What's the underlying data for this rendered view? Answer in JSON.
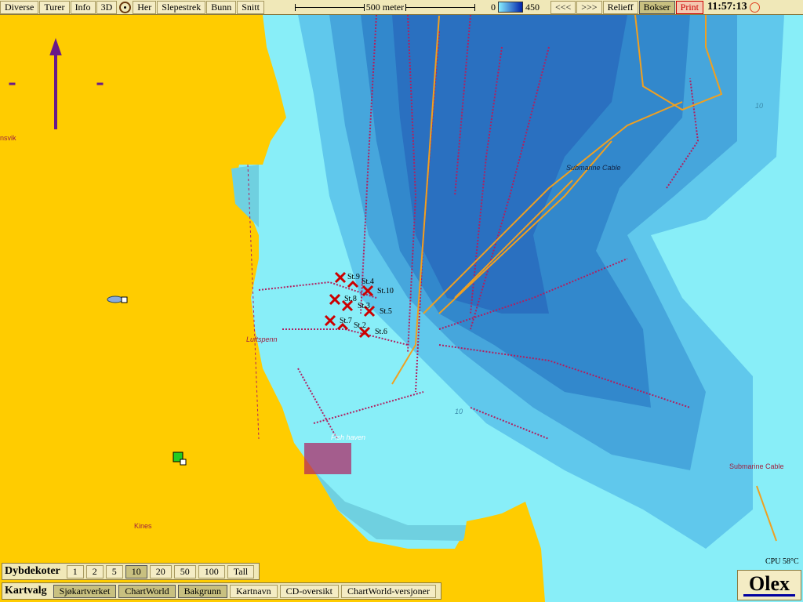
{
  "toolbar": {
    "buttons": [
      "Diverse",
      "Turer",
      "Info",
      "3D",
      "Her",
      "Slepestrek",
      "Bunn",
      "Snitt"
    ],
    "scale_label": "500 meter",
    "depth_min": "0",
    "depth_max": "450",
    "prev": "<<<",
    "next": ">>>",
    "relief": "Relieff",
    "bokser": "Bokser",
    "print": "Print",
    "time": "11:57:13"
  },
  "dybdekoter": {
    "label": "Dybdekoter",
    "options": [
      "1",
      "2",
      "5",
      "10",
      "20",
      "50",
      "100",
      "Tall"
    ],
    "selected": "10"
  },
  "kartvalg": {
    "label": "Kartvalg",
    "options": [
      {
        "label": "Sjøkartverket",
        "on": true
      },
      {
        "label": "ChartWorld",
        "on": true
      },
      {
        "label": "Bakgrunn",
        "on": true
      },
      {
        "label": "Kartnavn",
        "on": false
      },
      {
        "label": "CD-oversikt",
        "on": false
      },
      {
        "label": "ChartWorld-versjoner",
        "on": false
      }
    ]
  },
  "status": {
    "cpu": "CPU 58°C"
  },
  "logo": "Olex",
  "map": {
    "labels": {
      "ansvik": "nsvik",
      "luftspenn": "Luftspenn",
      "fish_haven": "Fish haven",
      "cable1": "Submarine Cable",
      "cable2": "Submarine Cable",
      "kines": "Kines",
      "d1": "10",
      "d2": "10"
    },
    "stations": [
      {
        "name": "St.9",
        "mark": "x"
      },
      {
        "name": "St.4",
        "mark": "chevron"
      },
      {
        "name": "St.10",
        "mark": "x"
      },
      {
        "name": "St.8",
        "mark": "x"
      },
      {
        "name": "St.3",
        "mark": "x"
      },
      {
        "name": "St.5",
        "mark": "x"
      },
      {
        "name": "St.7",
        "mark": "x"
      },
      {
        "name": "St.2",
        "mark": "chevron"
      },
      {
        "name": "St.6",
        "mark": "x"
      }
    ],
    "colors": {
      "land": "#ffcc00",
      "shallow": "#88eef8",
      "deep": "#2a70c8",
      "tracks": "#b02060",
      "cable": "#f0a020"
    }
  }
}
